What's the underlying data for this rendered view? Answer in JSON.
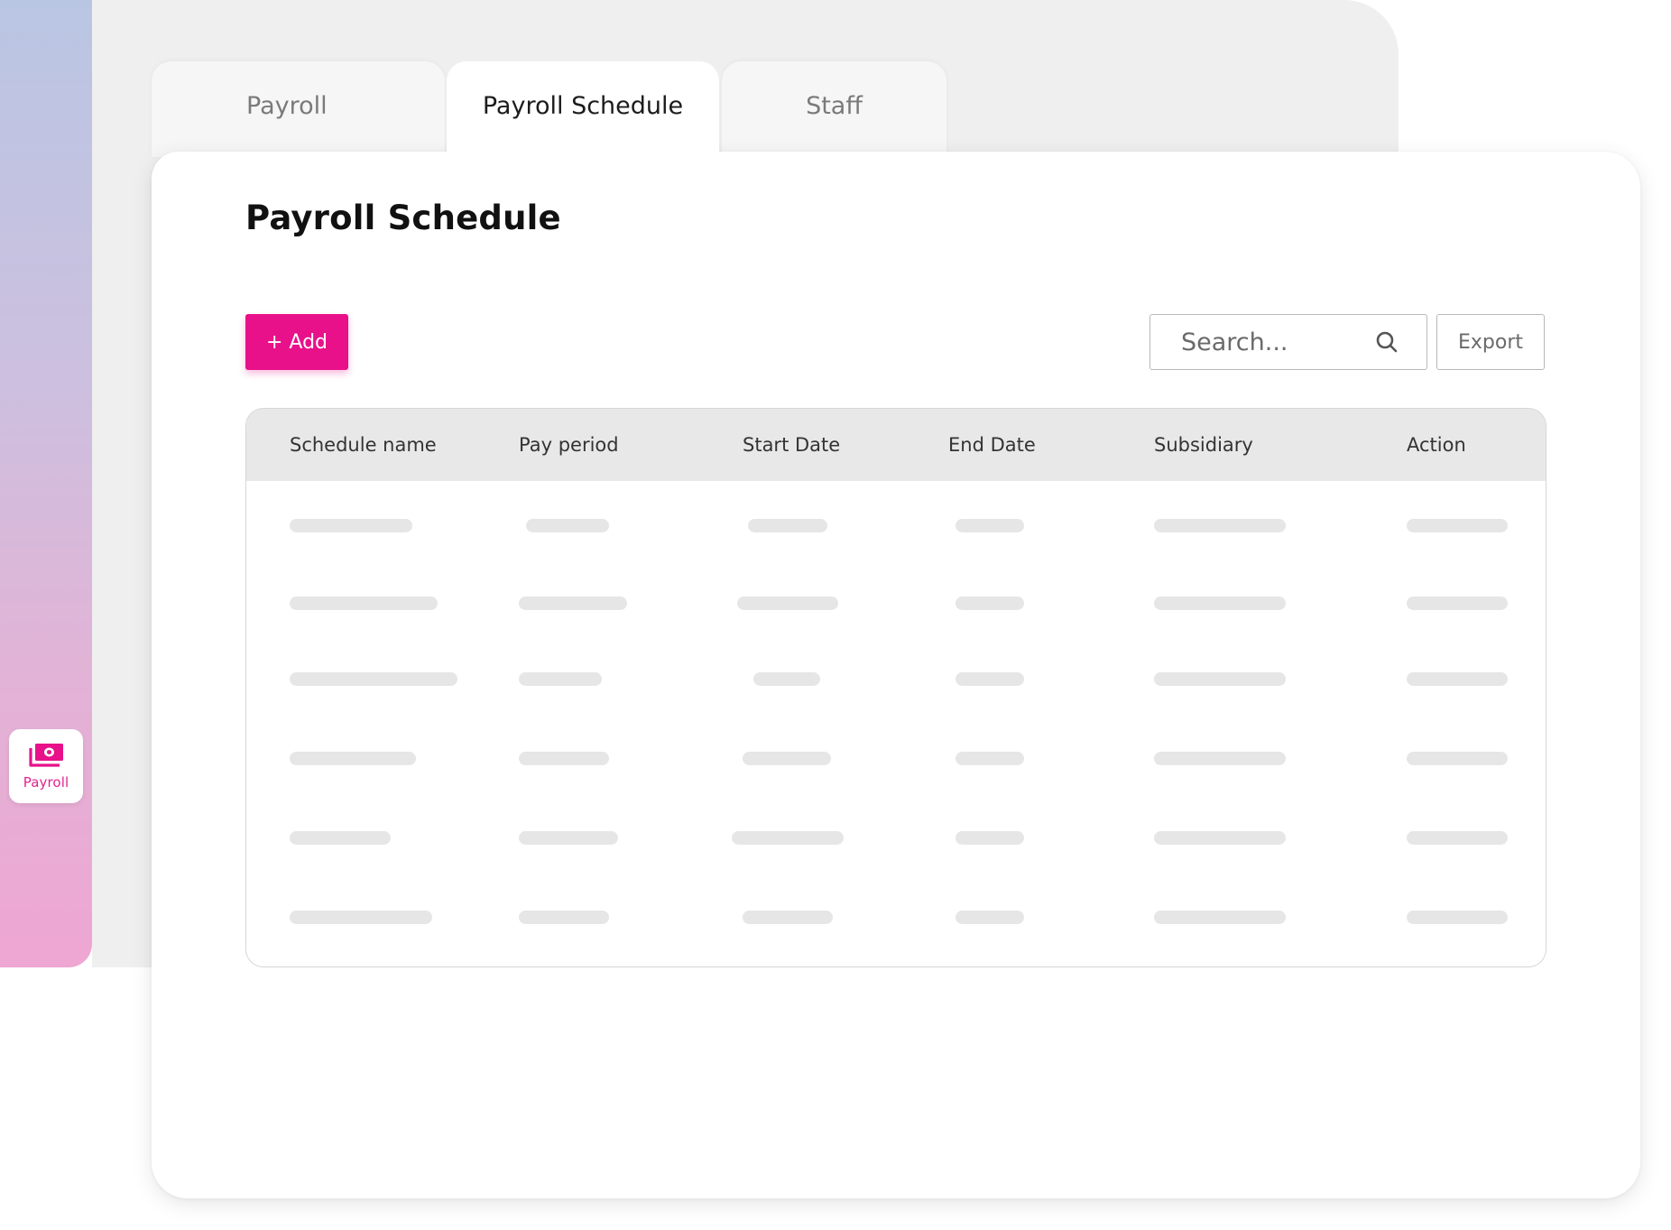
{
  "sidebar": {
    "items": [
      {
        "label": "Payroll",
        "icon": "money-icon",
        "active": true
      }
    ]
  },
  "tabs": [
    {
      "label": "Payroll",
      "active": false
    },
    {
      "label": "Payroll Schedule",
      "active": true
    },
    {
      "label": "Staff",
      "active": false
    }
  ],
  "main": {
    "title": "Payroll Schedule",
    "add_label": "+ Add",
    "search": {
      "placeholder": "Search...",
      "value": ""
    },
    "export_label": "Export"
  },
  "table": {
    "columns": [
      "Schedule name",
      "Pay period",
      "Start Date",
      "End Date",
      "Subsidiary",
      "Action"
    ],
    "rows_loading": 6
  },
  "colors": {
    "accent": "#e8118a",
    "sidebar_gradient_top": "#b9c6e3",
    "sidebar_gradient_bottom": "#eea6d2",
    "header_bg": "#e8e8e8",
    "skeleton": "#e6e6e6"
  }
}
